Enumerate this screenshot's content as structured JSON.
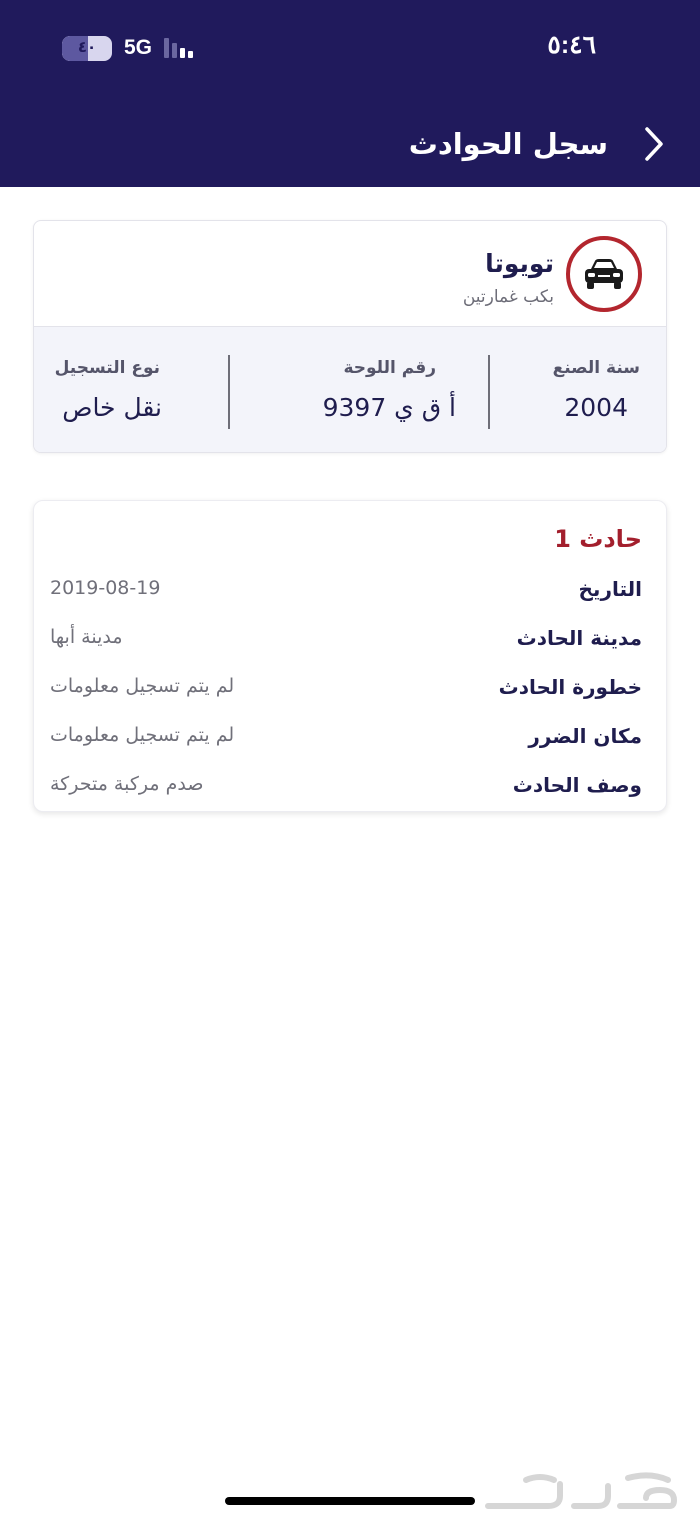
{
  "status_bar": {
    "time": "٥:٤٦",
    "network": "5G",
    "battery_level": "٤٠"
  },
  "header": {
    "title": "سجل الحوادث"
  },
  "vehicle": {
    "brand": "تويوتا",
    "model": "بكب غمارتين",
    "details": [
      {
        "label": "سنة الصنع",
        "value": "2004"
      },
      {
        "label": "رقم اللوحة",
        "value": "أ ق ي 9397"
      },
      {
        "label": "نوع التسجيل",
        "value": "نقل خاص"
      }
    ]
  },
  "accident": {
    "title": "حادث 1",
    "rows": [
      {
        "label": "التاريخ",
        "value": "2019-08-19"
      },
      {
        "label": "مدينة الحادث",
        "value": "مدينة أبها"
      },
      {
        "label": "خطورة الحادث",
        "value": "لم يتم تسجيل معلومات"
      },
      {
        "label": "مكان الضرر",
        "value": "لم يتم تسجيل معلومات"
      },
      {
        "label": "وصف الحادث",
        "value": "صدم مركبة متحركة"
      }
    ]
  },
  "colors": {
    "header_bg": "#201a5c",
    "accent_red": "#a31f2d",
    "text_dark": "#1f1d4e"
  },
  "watermark": {
    "text": "حراج"
  },
  "icons": {
    "back": "chevron-right-icon",
    "brand": "car-icon",
    "battery": "battery-icon",
    "signal": "signal-icon"
  }
}
